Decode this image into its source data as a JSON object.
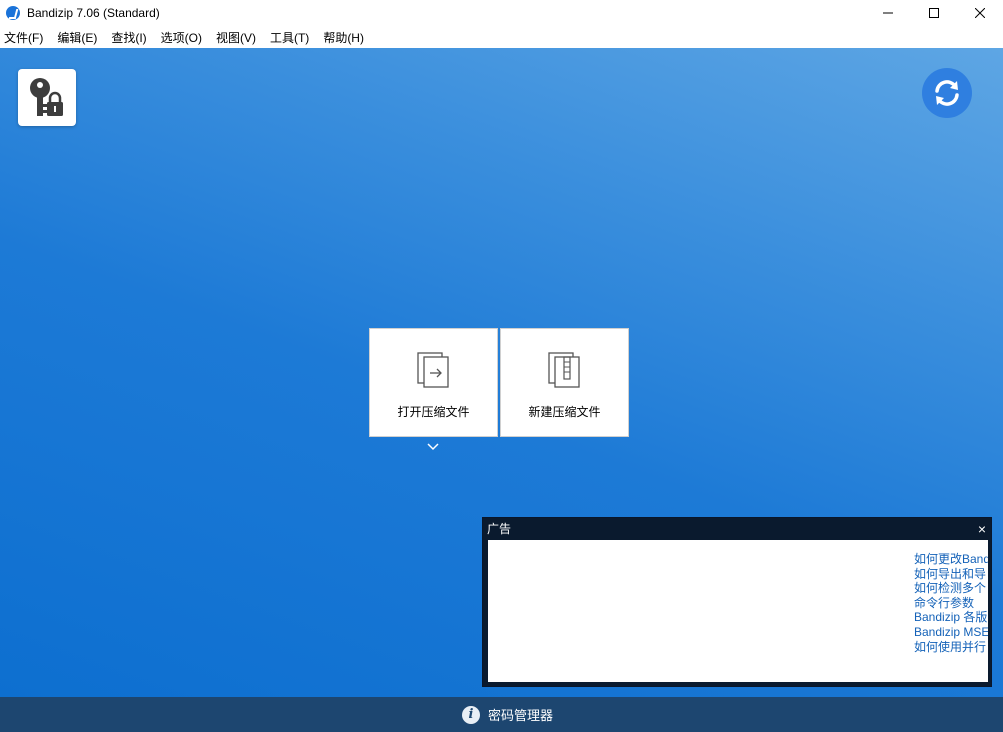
{
  "window": {
    "title": "Bandizip 7.06 (Standard)"
  },
  "menu": [
    {
      "label": "文件(F)"
    },
    {
      "label": "编辑(E)"
    },
    {
      "label": "查找(I)"
    },
    {
      "label": "选项(O)"
    },
    {
      "label": "视图(V)"
    },
    {
      "label": "工具(T)"
    },
    {
      "label": "帮助(H)"
    }
  ],
  "main": {
    "open_archive_label": "打开压缩文件",
    "new_archive_label": "新建压缩文件"
  },
  "ad": {
    "title": "广告",
    "close": "×",
    "links": [
      "如何更改Band",
      "如何导出和导",
      "如何检测多个",
      "命令行参数",
      "Bandizip 各版",
      "Bandizip MSE",
      "如何使用并行"
    ]
  },
  "status": {
    "password_manager_label": "密码管理器"
  },
  "colors": {
    "accent": "#1d7ad6",
    "statusbar": "#1d4670",
    "link": "#1462b8"
  }
}
